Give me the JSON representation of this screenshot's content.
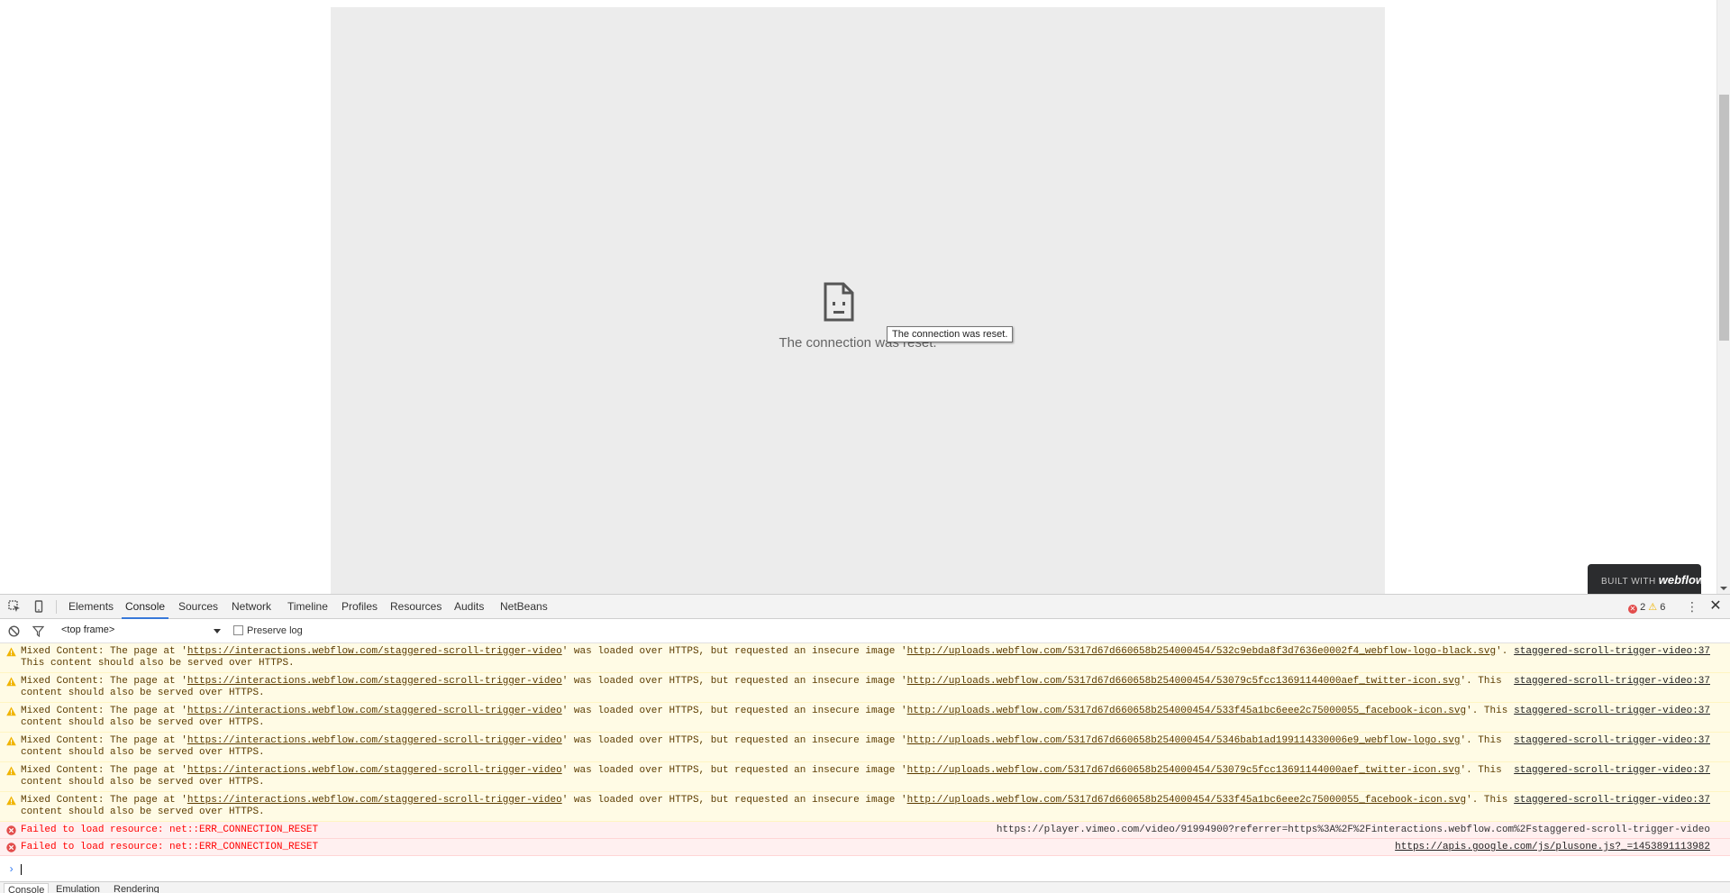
{
  "page": {
    "error_message": "The connection was reset.",
    "tooltip": "The connection was reset.",
    "badge": {
      "prefix": "BUILT WITH",
      "brand": "webflow"
    }
  },
  "devtools": {
    "tabs": [
      "Elements",
      "Console",
      "Sources",
      "Network",
      "Timeline",
      "Profiles",
      "Resources",
      "Audits",
      "NetBeans"
    ],
    "active_tab": "Console",
    "error_count": "2",
    "warning_count": "6",
    "context_select": "<top frame>",
    "preserve_log_label": "Preserve log",
    "messages": [
      {
        "prefix": "Mixed Content: The page at '",
        "page_url": "https://interactions.webflow.com/staggered-scroll-trigger-video",
        "middle": "' was loaded over HTTPS, but requested an insecure image '",
        "resource_url": "http://uploads.webflow.com/5317d67d660658b254000454/532c9ebda8f3d7636e0002f4_webflow-logo-black.svg",
        "suffix": "'. This content should also be served over HTTPS.",
        "source": "staggered-scroll-trigger-video:37"
      },
      {
        "prefix": "Mixed Content: The page at '",
        "page_url": "https://interactions.webflow.com/staggered-scroll-trigger-video",
        "middle": "' was loaded over HTTPS, but requested an insecure image '",
        "resource_url": "http://uploads.webflow.com/5317d67d660658b254000454/53079c5fcc13691144000aef_twitter-icon.svg",
        "suffix": "'. This content should also be served over HTTPS.",
        "source": "staggered-scroll-trigger-video:37"
      },
      {
        "prefix": "Mixed Content: The page at '",
        "page_url": "https://interactions.webflow.com/staggered-scroll-trigger-video",
        "middle": "' was loaded over HTTPS, but requested an insecure image '",
        "resource_url": "http://uploads.webflow.com/5317d67d660658b254000454/533f45a1bc6eee2c75000055_facebook-icon.svg",
        "suffix": "'. This content should also be served over HTTPS.",
        "source": "staggered-scroll-trigger-video:37"
      },
      {
        "prefix": "Mixed Content: The page at '",
        "page_url": "https://interactions.webflow.com/staggered-scroll-trigger-video",
        "middle": "' was loaded over HTTPS, but requested an insecure image '",
        "resource_url": "http://uploads.webflow.com/5317d67d660658b254000454/5346bab1ad199114330006e9_webflow-logo.svg",
        "suffix": "'. This content should also be served over HTTPS.",
        "source": "staggered-scroll-trigger-video:37"
      },
      {
        "prefix": "Mixed Content: The page at '",
        "page_url": "https://interactions.webflow.com/staggered-scroll-trigger-video",
        "middle": "' was loaded over HTTPS, but requested an insecure image '",
        "resource_url": "http://uploads.webflow.com/5317d67d660658b254000454/53079c5fcc13691144000aef_twitter-icon.svg",
        "suffix": "'. This content should also be served over HTTPS.",
        "source": "staggered-scroll-trigger-video:37"
      },
      {
        "prefix": "Mixed Content: The page at '",
        "page_url": "https://interactions.webflow.com/staggered-scroll-trigger-video",
        "middle": "' was loaded over HTTPS, but requested an insecure image '",
        "resource_url": "http://uploads.webflow.com/5317d67d660658b254000454/533f45a1bc6eee2c75000055_facebook-icon.svg",
        "suffix": "'. This content should also be served over HTTPS.",
        "source": "staggered-scroll-trigger-video:37"
      }
    ],
    "errors": [
      {
        "text": "Failed to load resource: net::ERR_CONNECTION_RESET",
        "source": "https://player.vimeo.com/video/91994900?referrer=https%3A%2F%2Finteractions.webflow.com%2Fstaggered-scroll-trigger-video"
      },
      {
        "text": "Failed to load resource: net::ERR_CONNECTION_RESET",
        "source": "https://apis.google.com/js/plusone.js?_=1453891113982"
      }
    ],
    "drawer_tabs": [
      "Console",
      "Emulation",
      "Rendering"
    ],
    "active_drawer_tab": "Console",
    "colors": {
      "accent": "#3879d9",
      "warning_bg": "#fffbe5",
      "error_bg": "#fff0f0",
      "error_text": "#ff0000"
    }
  }
}
